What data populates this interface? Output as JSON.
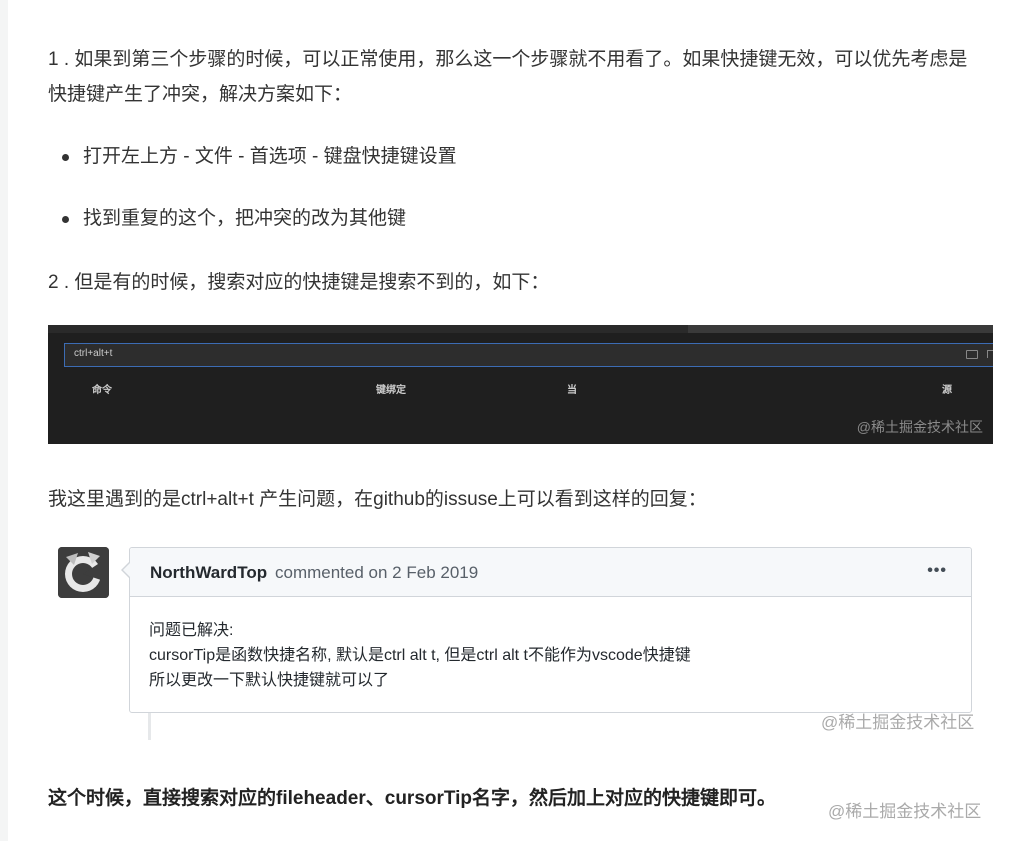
{
  "article": {
    "para1": "1 . 如果到第三个步骤的时候，可以正常使用，那么这一个步骤就不用看了。如果快捷键无效，可以优先考虑是快捷键产生了冲突，解决方案如下：",
    "bullets": [
      "打开左上方 - 文件 - 首选项 - 键盘快捷键设置",
      "找到重复的这个，把冲突的改为其他键"
    ],
    "para2": "2 . 但是有的时候，搜索对应的快捷键是搜索不到的，如下：",
    "para3": "我这里遇到的是ctrl+alt+t 产生问题，在github的issuse上可以看到这样的回复：",
    "para4": "这个时候，直接搜索对应的fileheader、cursorTip名字，然后加上对应的快捷键即可。"
  },
  "screenshot": {
    "search_value": "ctrl+alt+t",
    "columns": [
      "命令",
      "键绑定",
      "当",
      "源"
    ],
    "watermark": "@稀土掘金技术社区",
    "icons": [
      "keyboard-icon",
      "sort-icon"
    ]
  },
  "comment": {
    "author": "NorthWardTop",
    "meta": "commented on 2 Feb 2019",
    "menu": "•••",
    "lines": [
      "问题已解决:",
      "cursorTip是函数快捷名称, 默认是ctrl alt t, 但是ctrl alt t不能作为vscode快捷键",
      "所以更改一下默认快捷键就可以了"
    ],
    "watermark": "@稀土掘金技术社区"
  },
  "page_watermark": "@稀土掘金技术社区",
  "colors": {
    "text": "#333333",
    "dark_bg": "#1f1f1f",
    "search_border": "#3c6cb4",
    "comment_border": "#d1d5da",
    "comment_header": "#f6f8fa"
  }
}
